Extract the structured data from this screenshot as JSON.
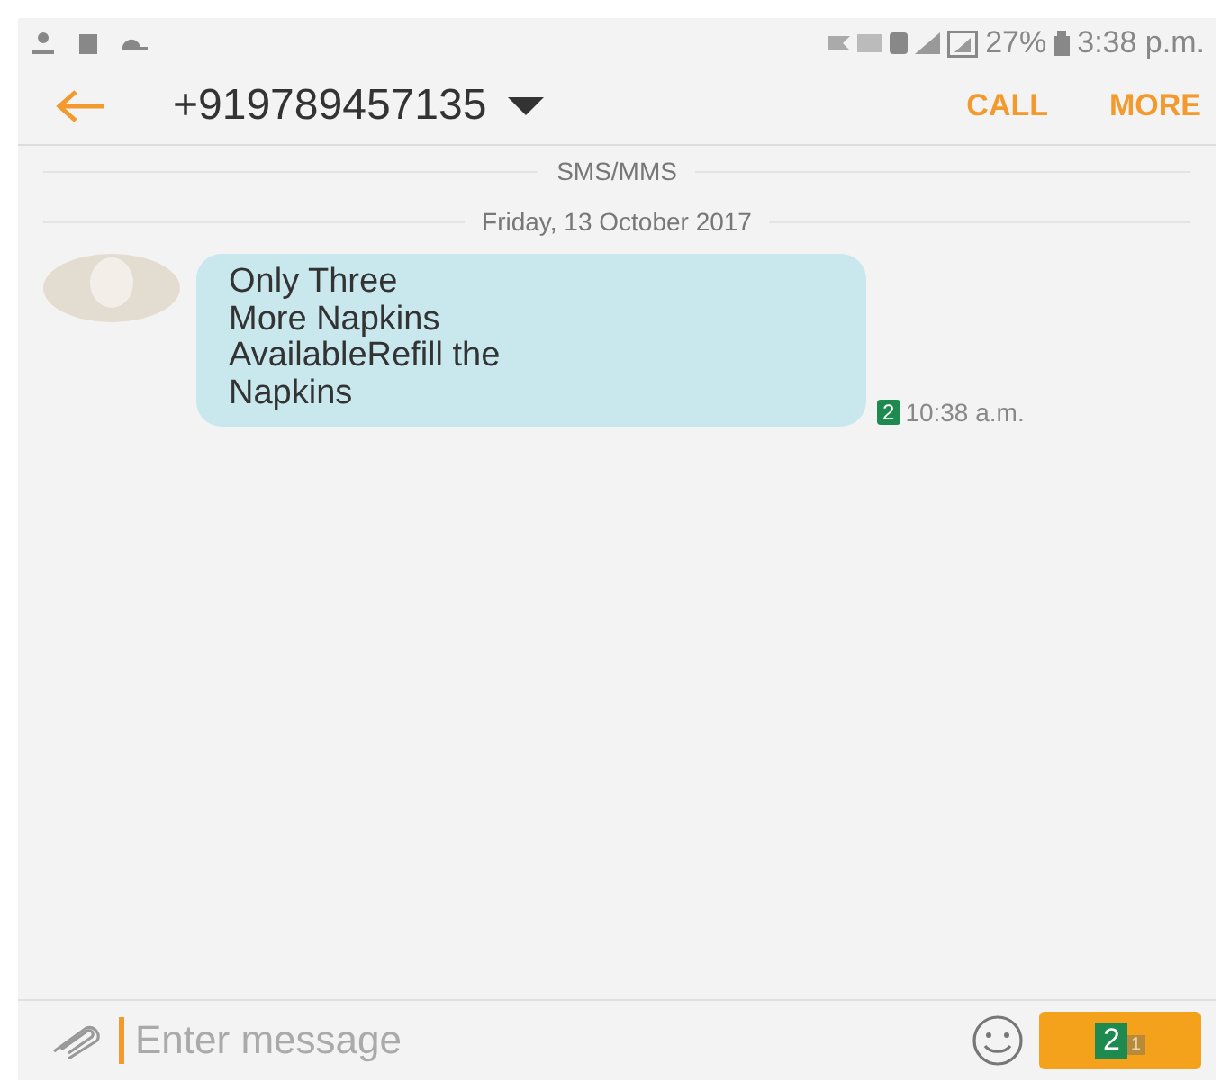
{
  "status_bar": {
    "battery": "27%",
    "time": "3:38 p.m."
  },
  "header": {
    "title": "+919789457135",
    "actions": [
      "CALL",
      "MORE"
    ]
  },
  "thread": {
    "channel": "SMS/MMS",
    "date": "Friday, 13 October 2017"
  },
  "messages": [
    {
      "text": "Only Three\nMore Napkins\nAvailableRefill the\nNapkins",
      "sim": "2",
      "time": "10:38 a.m."
    }
  ],
  "composer": {
    "placeholder": "Enter message",
    "send_sim": "2",
    "send_sub": "1"
  }
}
